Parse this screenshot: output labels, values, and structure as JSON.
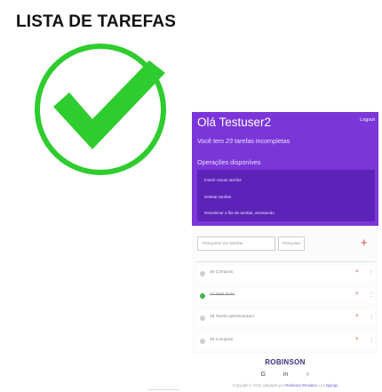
{
  "page": {
    "title": "LISTA DE TAREFAS"
  },
  "colors": {
    "check": "#2ecc2e",
    "header_bg": "#7b36d9",
    "ops_bg": "#5d23b8",
    "accent_red": "#d93a3a",
    "done_green": "#3cb44b"
  },
  "icons": {
    "check": "check-mark-icon"
  },
  "app": {
    "greeting": "Olá Testuser2",
    "logout": "Logout",
    "subtitle_pre": "Você tem ",
    "subtitle_count": "23",
    "subtitle_post": " tarefas incompletas",
    "ops_heading": "Operações disponíves",
    "operations": [
      {
        "label": "Inserir novas tarefas"
      },
      {
        "label": "Deletar tarefas"
      },
      {
        "label": "Reordenar a fila de tarefas, arrastando"
      }
    ],
    "search": {
      "placeholder": "Pesquisar em tarefas",
      "button": "Pesquisa"
    },
    "add_label": "+",
    "tasks": [
      {
        "name": "26 Compras",
        "done": false,
        "delete": "×",
        "more": "⋮"
      },
      {
        "name": "27 Task Todo",
        "done": true,
        "delete": "×",
        "more": "⋮"
      },
      {
        "name": "28 Tarefa administrador",
        "done": false,
        "delete": "×",
        "more": "⋮"
      },
      {
        "name": "29 Compras",
        "done": false,
        "delete": "×",
        "more": "⋮"
      }
    ],
    "footer": {
      "name": "ROBINSON",
      "social": [
        "G",
        "in",
        "○"
      ],
      "copy_pre": "Copyright © 2022 adaptado por ",
      "copy_link": "Robinson Ernedino",
      "copy_mid": " com ",
      "copy_django": "Django"
    }
  }
}
